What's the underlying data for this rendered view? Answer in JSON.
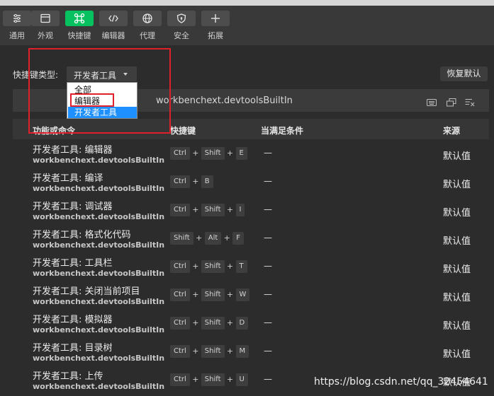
{
  "toolbar": {
    "items": [
      {
        "label": "通用",
        "icon": "list-settings-icon"
      },
      {
        "label": "外观",
        "icon": "window-layout-icon"
      },
      {
        "label": "快捷键",
        "icon": "command-key-icon",
        "active": true
      },
      {
        "label": "编辑器",
        "icon": "code-brackets-icon"
      },
      {
        "label": "代理",
        "icon": "globe-icon"
      },
      {
        "label": "安全",
        "icon": "shield-icon"
      },
      {
        "label": "拓展",
        "icon": "plus-icon"
      }
    ],
    "active_color": "#07c160"
  },
  "shortcut_type": {
    "label": "快捷键类型:",
    "selected": "开发者工具",
    "options": [
      "全部",
      "编辑器",
      "开发者工具"
    ]
  },
  "reset_label": "恢复默认",
  "filter_text": "workbenchext.devtoolsBuiltIn",
  "table": {
    "headers": {
      "command": "功能或命令",
      "shortcut": "快捷键",
      "condition": "当满足条件",
      "source": "来源"
    },
    "rows": [
      {
        "title": "开发者工具: 编辑器",
        "cmd": "workbenchext.devtoolsBuiltIn.t...",
        "keys": [
          "Ctrl",
          "Shift",
          "E"
        ],
        "cond": "—",
        "src": "默认值"
      },
      {
        "title": "开发者工具: 编译",
        "cmd": "workbenchext.devtoolsBuiltIn.r...",
        "keys": [
          "Ctrl",
          "B"
        ],
        "cond": "—",
        "src": "默认值"
      },
      {
        "title": "开发者工具: 调试器",
        "cmd": "workbenchext.devtoolsBuiltIn.t...",
        "keys": [
          "Ctrl",
          "Shift",
          "I"
        ],
        "cond": "—",
        "src": "默认值"
      },
      {
        "title": "开发者工具: 格式化代码",
        "cmd": "workbenchext.devtoolsBuiltIn.f...",
        "keys": [
          "Shift",
          "Alt",
          "F"
        ],
        "cond": "—",
        "src": "默认值"
      },
      {
        "title": "开发者工具: 工具栏",
        "cmd": "workbenchext.devtoolsBuiltIn.t...",
        "keys": [
          "Ctrl",
          "Shift",
          "T"
        ],
        "cond": "—",
        "src": "默认值"
      },
      {
        "title": "开发者工具: 关闭当前项目",
        "cmd": "workbenchext.devtoolsBuiltIn.cl...",
        "keys": [
          "Ctrl",
          "Shift",
          "W"
        ],
        "cond": "—",
        "src": "默认值"
      },
      {
        "title": "开发者工具: 模拟器",
        "cmd": "workbenchext.devtoolsBuiltIn.t...",
        "keys": [
          "Ctrl",
          "Shift",
          "D"
        ],
        "cond": "—",
        "src": "默认值"
      },
      {
        "title": "开发者工具: 目录树",
        "cmd": "workbenchext.devtoolsBuiltIn.t...",
        "keys": [
          "Ctrl",
          "Shift",
          "M"
        ],
        "cond": "—",
        "src": "默认值"
      },
      {
        "title": "开发者工具: 上传",
        "cmd": "workbenchext.devtoolsBuiltIn.u...",
        "keys": [
          "Ctrl",
          "Shift",
          "U"
        ],
        "cond": "—",
        "src": "默认值"
      }
    ]
  },
  "watermark": "https://blog.csdn.net/qq_32454641",
  "annotation_color": "#e0202a"
}
